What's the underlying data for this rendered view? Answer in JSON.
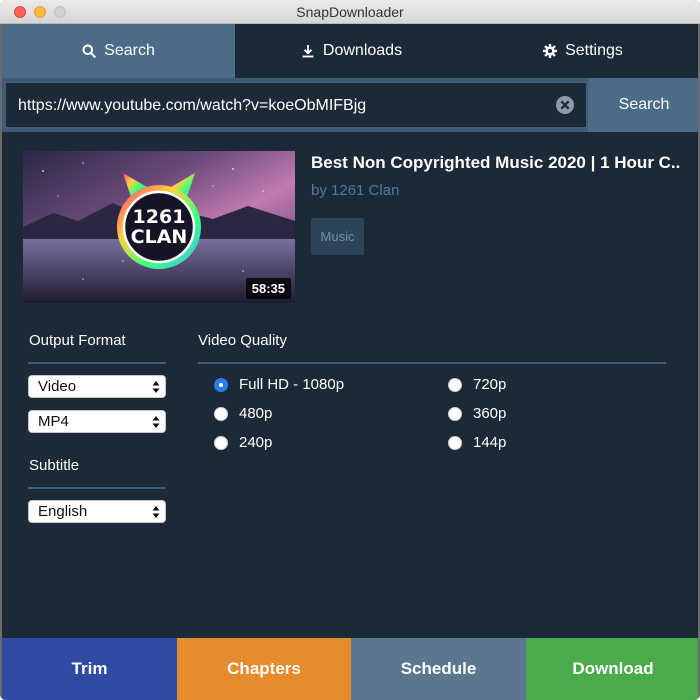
{
  "window": {
    "title": "SnapDownloader"
  },
  "tabs": [
    {
      "label": "Search",
      "icon": "search-icon",
      "active": true
    },
    {
      "label": "Downloads",
      "icon": "download-icon",
      "active": false
    },
    {
      "label": "Settings",
      "icon": "gear-icon",
      "active": false
    }
  ],
  "search": {
    "value": "https://www.youtube.com/watch?v=koeObMIFBjg",
    "button_label": "Search",
    "clear_icon": "clear-icon"
  },
  "video": {
    "title": "Best Non Copyrighted Music 2020 | 1 Hour C...",
    "author": "by 1261 Clan",
    "tag": "Music",
    "duration": "58:35",
    "thumbnail_logo_line1": "1261",
    "thumbnail_logo_line2": "CLAN"
  },
  "output_format": {
    "label": "Output Format",
    "type_selected": "Video",
    "container_selected": "MP4"
  },
  "subtitle": {
    "label": "Subtitle",
    "selected": "English"
  },
  "video_quality": {
    "label": "Video Quality",
    "options": [
      {
        "label": "Full HD - 1080p",
        "checked": true
      },
      {
        "label": "720p",
        "checked": false
      },
      {
        "label": "480p",
        "checked": false
      },
      {
        "label": "360p",
        "checked": false
      },
      {
        "label": "240p",
        "checked": false
      },
      {
        "label": "144p",
        "checked": false
      }
    ]
  },
  "actions": {
    "trim": "Trim",
    "chapters": "Chapters",
    "schedule": "Schedule",
    "download": "Download"
  },
  "colors": {
    "background": "#1c2a38",
    "tab_active": "#4b6b88",
    "trim": "#2f4ba3",
    "chapters": "#e68a2e",
    "schedule": "#5c7690",
    "download": "#4aab4c",
    "radio_checked": "#2b7df6"
  }
}
